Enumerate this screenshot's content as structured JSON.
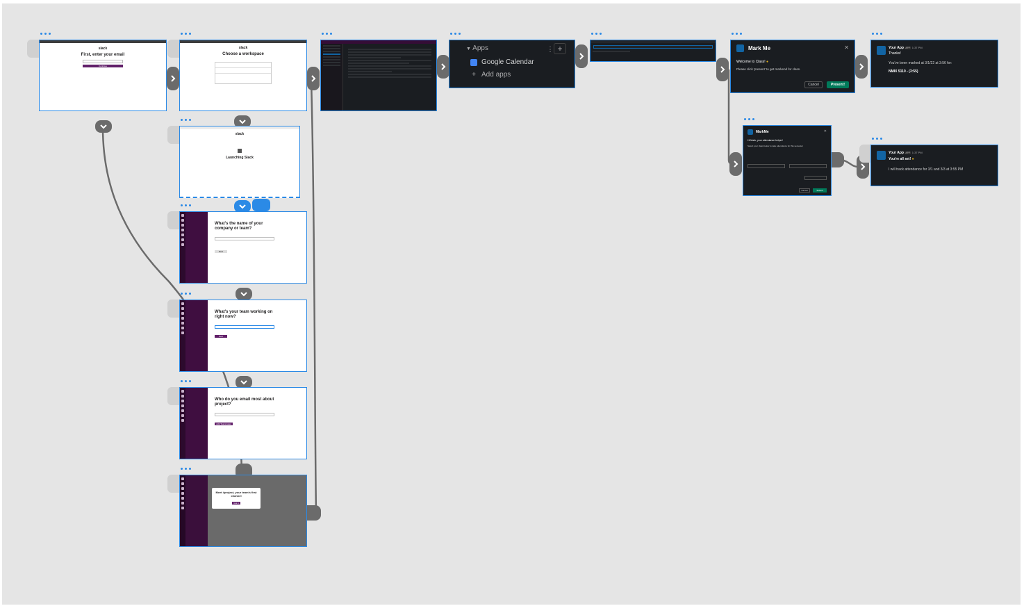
{
  "frames": {
    "email": {
      "brand": "slack",
      "title": "First, enter your email",
      "button": "Continue"
    },
    "workspace": {
      "brand": "slack",
      "title": "Choose a workspace"
    },
    "launching": {
      "brand": "slack",
      "title": "Launching Slack"
    },
    "company": {
      "title": "What's the name of your company or team?",
      "button": "Next"
    },
    "working": {
      "title": "What's your team working on right now?",
      "button": "Next"
    },
    "emailmost": {
      "title": "Who do you email most about project?",
      "button": "Add Teammates"
    },
    "meet": {
      "title": "Meet #project, your team's first channel",
      "button": "Got it"
    },
    "apps": {
      "section": "Apps",
      "items": [
        "Google Calendar",
        "Add apps"
      ],
      "add_icon": "plus-icon"
    },
    "markme": {
      "title": "Mark Me",
      "welcome": "Welcome to Class!",
      "body": "Please click 'present' to get markend for class.",
      "cancel": "Cancel",
      "submit": "Present!"
    },
    "thanks": {
      "app": "Your App",
      "badge": "APP",
      "time": "1:37 PM",
      "line1": "Thanks!",
      "line2": "You've been marked at 3/1/22 at 3:56 for:",
      "line3": "NMIX 5110 - (3:55)"
    },
    "markme2": {
      "title": "MarkMe",
      "greeting": "Hi Mark, your attendance helper!",
      "line": "Select your class below to take attendance for this semester",
      "cancel": "Cancel",
      "submit": "Submit"
    },
    "allset": {
      "app": "Your App",
      "badge": "APP",
      "time": "1:37 PM",
      "line1": "You're all set!",
      "line2": "I will track attendance for 3/1 and 3/3 at 3:55 PM"
    }
  },
  "colors": {
    "selection": "#2b8ae6",
    "canvas": "#e5e5e5",
    "connector": "#6b6b6b",
    "slack_purple": "#4a154b",
    "green": "#007a5a"
  }
}
